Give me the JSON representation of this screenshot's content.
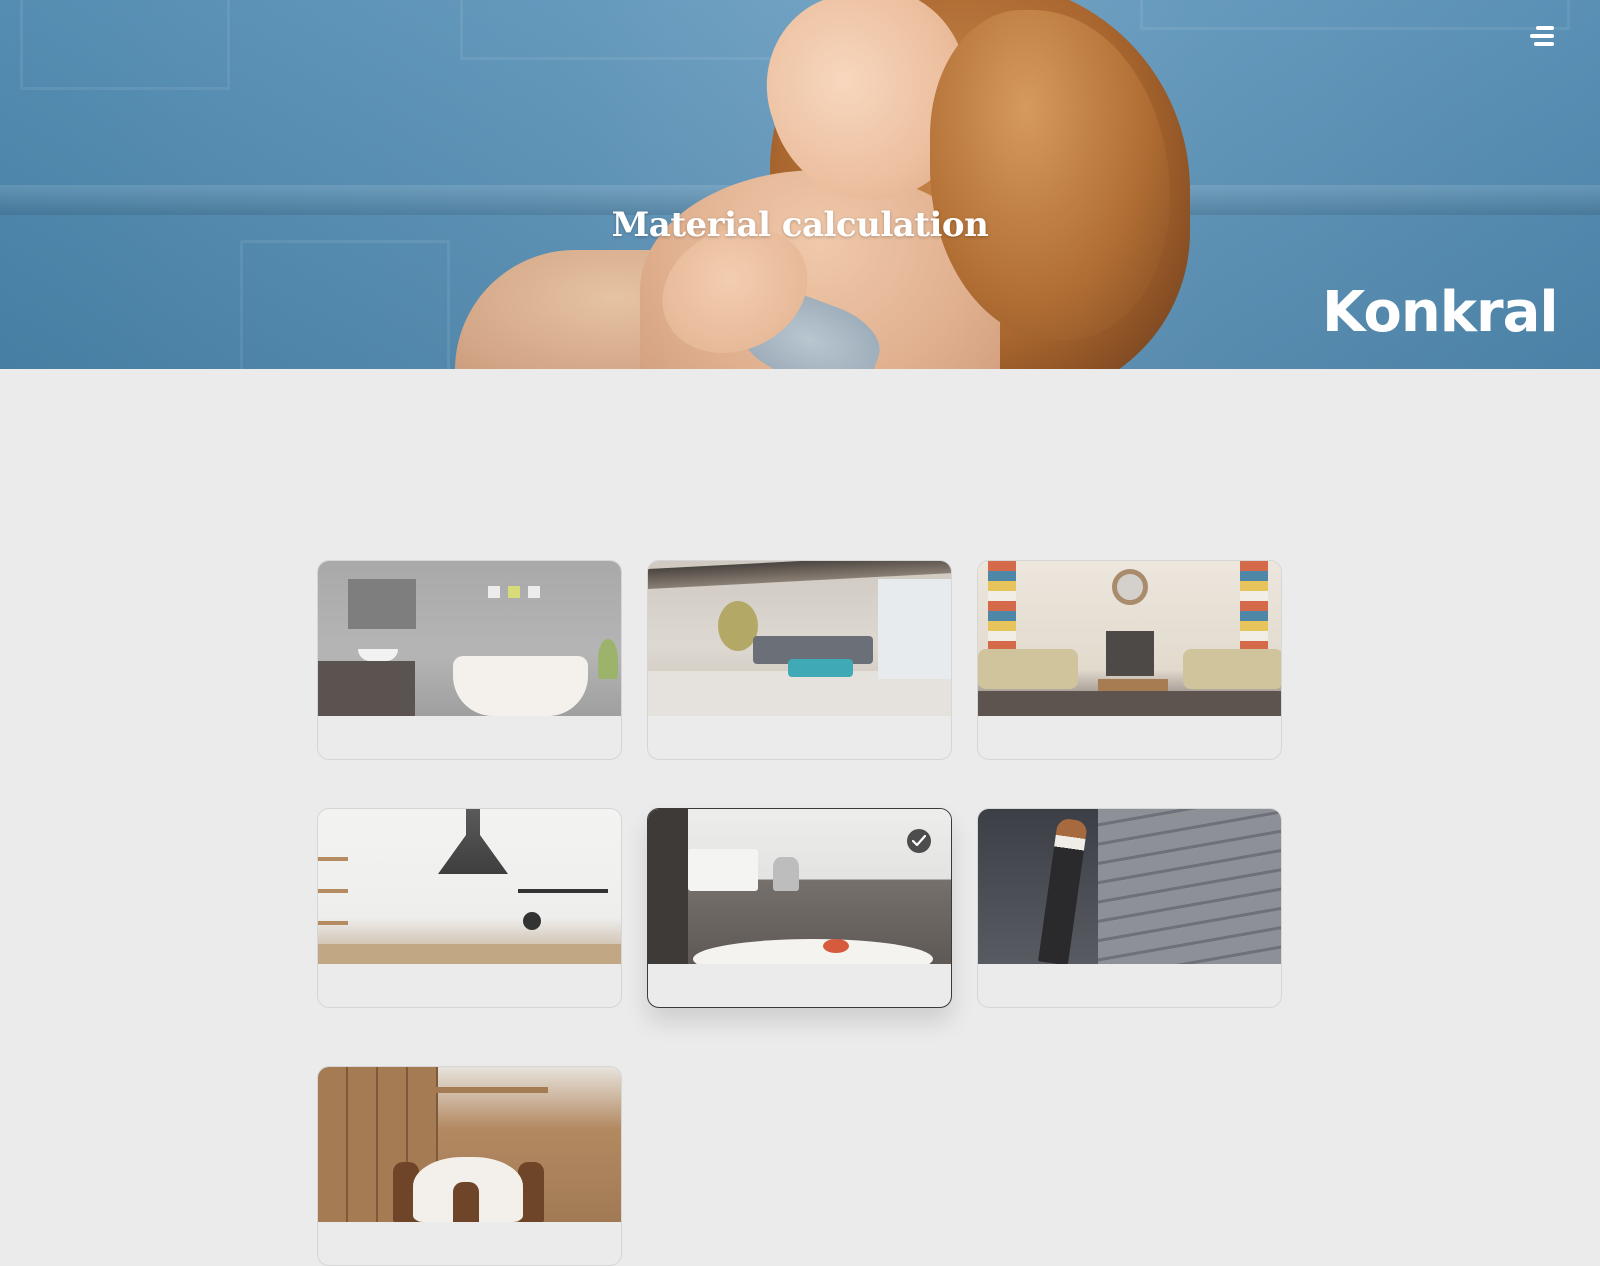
{
  "header": {
    "title": "Material calculation",
    "logo_text": "Konkral",
    "menu_icon": "hamburger-icon"
  },
  "rooms": [
    {
      "scene": "bathroom",
      "label": "",
      "selected": false
    },
    {
      "scene": "living-room",
      "label": "",
      "selected": false
    },
    {
      "scene": "lounge",
      "label": "",
      "selected": false
    },
    {
      "scene": "kitchen",
      "label": "",
      "selected": false
    },
    {
      "scene": "kitchen-table",
      "label": "",
      "selected": true
    },
    {
      "scene": "stairs",
      "label": "",
      "selected": false
    },
    {
      "scene": "dining-kitchen",
      "label": "",
      "selected": false
    }
  ],
  "colors": {
    "page_bg": "#ebebeb",
    "card_border": "#d6d6d6",
    "selected_border": "#3a3a3a",
    "check_bg": "#4d4d4d",
    "hero_blue": "#5b93b8"
  }
}
